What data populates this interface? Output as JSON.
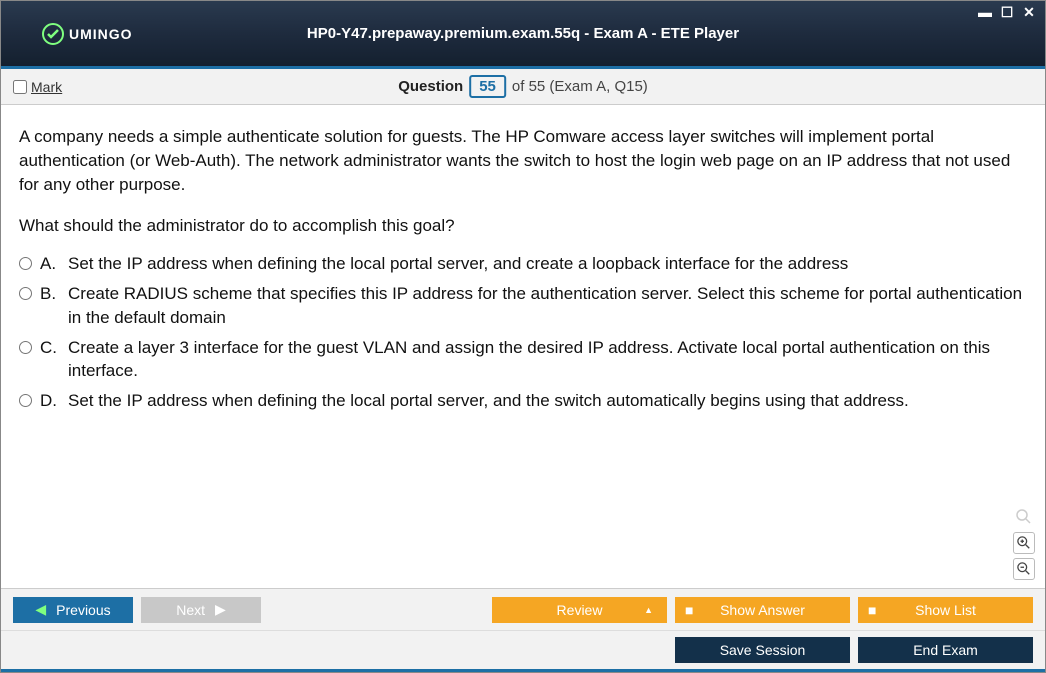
{
  "window": {
    "title": "HP0-Y47.prepaway.premium.exam.55q - Exam A - ETE Player",
    "logo_text": "UMINGO"
  },
  "toolbar": {
    "mark_label": "Mark",
    "question_word": "Question",
    "current": "55",
    "total_suffix": "of 55 (Exam A, Q15)"
  },
  "content": {
    "prompt": "A company needs a simple authenticate solution for guests. The HP Comware access layer switches will implement portal authentication (or Web-Auth). The network administrator wants the switch to host the login web page on an IP address that not used for any other purpose.",
    "question": "What should the administrator do to accomplish this goal?",
    "options": [
      {
        "letter": "A.",
        "text": "Set the IP address when defining the local portal server, and create a loopback interface for the address"
      },
      {
        "letter": "B.",
        "text": "Create RADIUS scheme that specifies this IP address for the authentication server. Select this scheme for portal authentication in the default domain"
      },
      {
        "letter": "C.",
        "text": "Create a layer 3 interface for the guest VLAN and assign the desired IP address. Activate local portal authentication on this interface."
      },
      {
        "letter": "D.",
        "text": "Set the IP address when defining the local portal server, and the switch automatically begins using that address."
      }
    ]
  },
  "footer": {
    "previous": "Previous",
    "next": "Next",
    "review": "Review",
    "show_answer": "Show Answer",
    "show_list": "Show List",
    "save_session": "Save Session",
    "end_exam": "End Exam"
  }
}
